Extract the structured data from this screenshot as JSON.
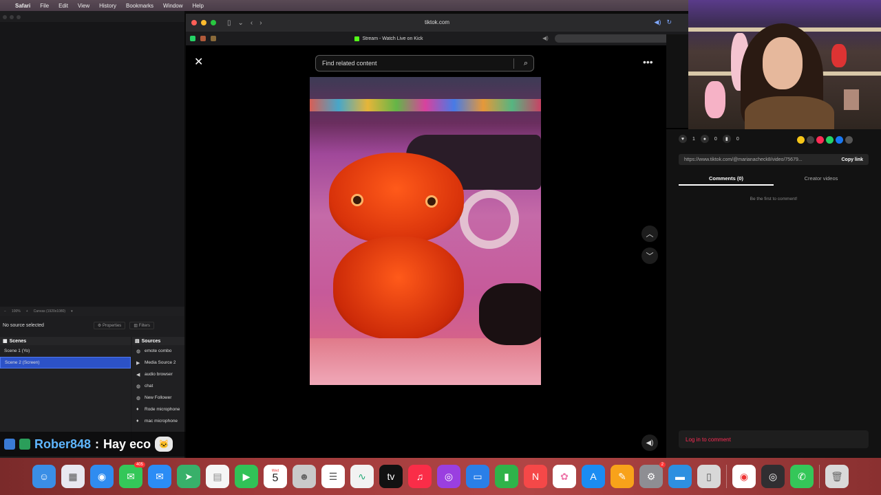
{
  "menubar": {
    "app_name": "Safari",
    "items": [
      "File",
      "Edit",
      "View",
      "History",
      "Bookmarks",
      "Window",
      "Help"
    ]
  },
  "obs": {
    "zoom": "100%",
    "canvas": "Canvas (1920x1080)",
    "no_source": "No source selected",
    "properties": "Properties",
    "filters": "Filters",
    "scenes_title": "Scenes",
    "sources_title": "Sources",
    "scenes": [
      "Scene 1 (Yo)",
      "Scene 2 (Screen)"
    ],
    "selected_scene_index": 1,
    "sources": [
      {
        "label": "emote combo",
        "icon": "globe-icon"
      },
      {
        "label": "Media Source 2",
        "icon": "play-icon"
      },
      {
        "label": "audio browser",
        "icon": "speaker-icon"
      },
      {
        "label": "chat",
        "icon": "globe-icon"
      },
      {
        "label": "New Follower",
        "icon": "globe-icon"
      },
      {
        "label": "Rode microphone",
        "icon": "mic-icon"
      },
      {
        "label": "mac microphone",
        "icon": "mic-icon"
      }
    ]
  },
  "chat": {
    "username": "Rober848",
    "separator": ":",
    "message": "Hay eco"
  },
  "safari": {
    "url": "tiktok.com",
    "tab_title": "Stream - Watch Live on Kick"
  },
  "tiktok": {
    "search_placeholder": "Find related content",
    "likes": "1",
    "comments_count": "0",
    "saves": "0",
    "link_url": "https://www.tiktok.com/@marianacheck8/video/75679...",
    "copy_link": "Copy link",
    "tab_comments": "Comments (0)",
    "tab_creator": "Creator videos",
    "empty_comments": "Be the first to comment!",
    "login": "Log in to comment"
  },
  "dock": {
    "calendar_month": "Wed",
    "calendar_day": "5",
    "messages_badge": "405",
    "settings_badge": "2"
  },
  "colors": {
    "selected_scene": "#2c52c7",
    "login_text": "#fe2c55",
    "chat_username": "#5fb6ff"
  }
}
